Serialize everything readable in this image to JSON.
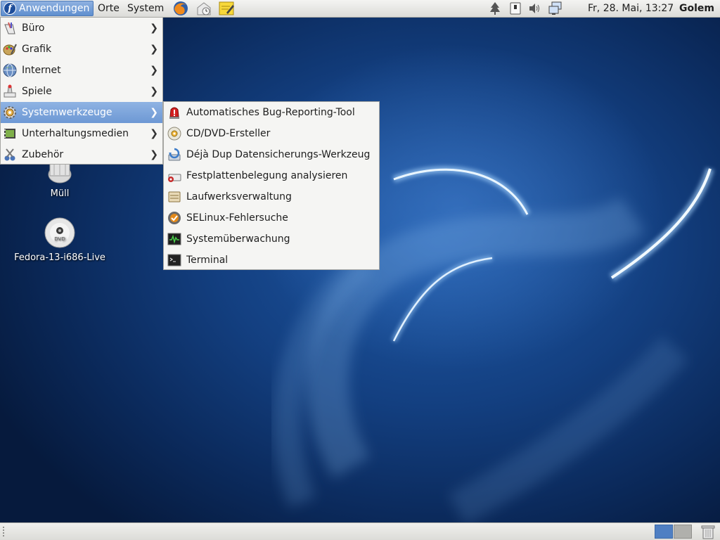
{
  "top_panel": {
    "menus": {
      "applications": "Anwendungen",
      "places": "Orte",
      "system": "System"
    },
    "launchers": [
      "firefox-icon",
      "evolution-mail-icon",
      "notes-editor-icon"
    ],
    "tray": [
      "tree-update-icon",
      "removable-media-icon",
      "volume-icon",
      "network-icon"
    ],
    "clock": "Fr, 28. Mai, 13:27",
    "user": "Golem"
  },
  "desktop": {
    "icons": [
      {
        "label": "Müll",
        "icon": "trash-icon"
      },
      {
        "label": "Fedora-13-i686-Live",
        "icon": "dvd-icon"
      }
    ],
    "dvd_disc_label": "DVD"
  },
  "applications_menu": {
    "items": [
      {
        "label": "Büro",
        "icon": "office-icon"
      },
      {
        "label": "Grafik",
        "icon": "graphics-icon"
      },
      {
        "label": "Internet",
        "icon": "internet-globe-icon"
      },
      {
        "label": "Spiele",
        "icon": "games-icon"
      },
      {
        "label": "Systemwerkzeuge",
        "icon": "system-tools-icon",
        "active": true
      },
      {
        "label": "Unterhaltungsmedien",
        "icon": "multimedia-icon"
      },
      {
        "label": "Zubehör",
        "icon": "accessories-icon"
      }
    ]
  },
  "system_tools_submenu": {
    "items": [
      {
        "label": "Automatisches Bug-Reporting-Tool",
        "icon": "bug-alert-icon"
      },
      {
        "label": "CD/DVD-Ersteller",
        "icon": "cd-burner-icon"
      },
      {
        "label": "Déjà Dup Datensicherungs-Werkzeug",
        "icon": "backup-icon"
      },
      {
        "label": "Festplattenbelegung analysieren",
        "icon": "disk-usage-icon"
      },
      {
        "label": "Laufwerksverwaltung",
        "icon": "drive-manager-icon"
      },
      {
        "label": "SELinux-Fehlersuche",
        "icon": "selinux-icon"
      },
      {
        "label": "Systemüberwachung",
        "icon": "system-monitor-icon"
      },
      {
        "label": "Terminal",
        "icon": "terminal-icon"
      }
    ]
  },
  "bottom_panel": {
    "workspaces": 2,
    "active_workspace": 1
  },
  "colors": {
    "menu_highlight": "#6d98d4",
    "desktop_blue": "#133f80",
    "panel_bg": "#e8e8e5"
  }
}
